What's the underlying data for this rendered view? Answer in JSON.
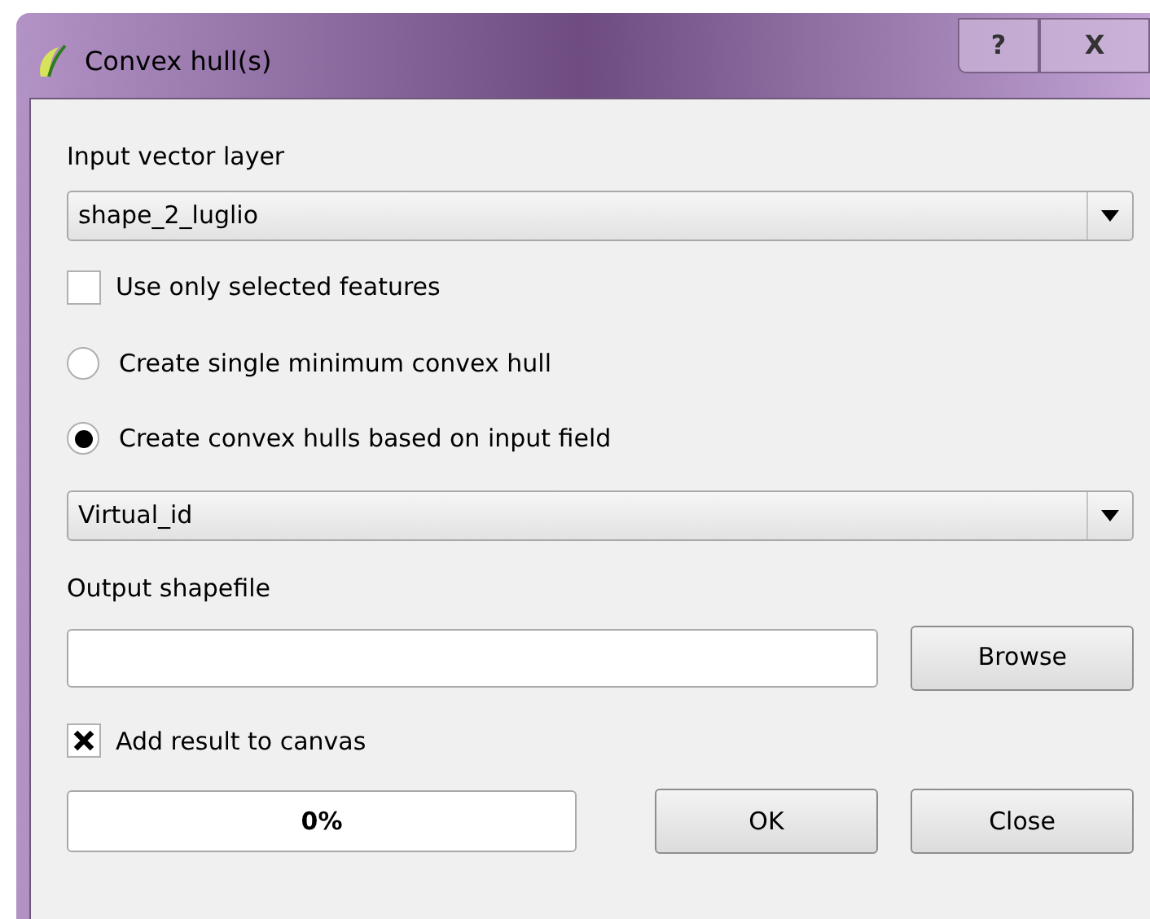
{
  "window": {
    "title": "Convex hull(s)",
    "help_button": "?",
    "close_button": "X"
  },
  "input_layer": {
    "label": "Input vector layer",
    "value": "shape_2_luglio"
  },
  "use_selected": {
    "label": "Use only selected features",
    "checked": false
  },
  "hull_mode": [
    {
      "label": "Create single minimum convex hull",
      "selected": false
    },
    {
      "label": "Create convex hulls based on input field",
      "selected": true
    }
  ],
  "field": {
    "value": "Virtual_id"
  },
  "output": {
    "label": "Output shapefile",
    "browse": "Browse"
  },
  "add_to_canvas": {
    "label": "Add result to canvas",
    "checked": true
  },
  "progress": {
    "level": 0,
    "text": "0%"
  },
  "buttons": [
    "OK",
    "Close"
  ]
}
